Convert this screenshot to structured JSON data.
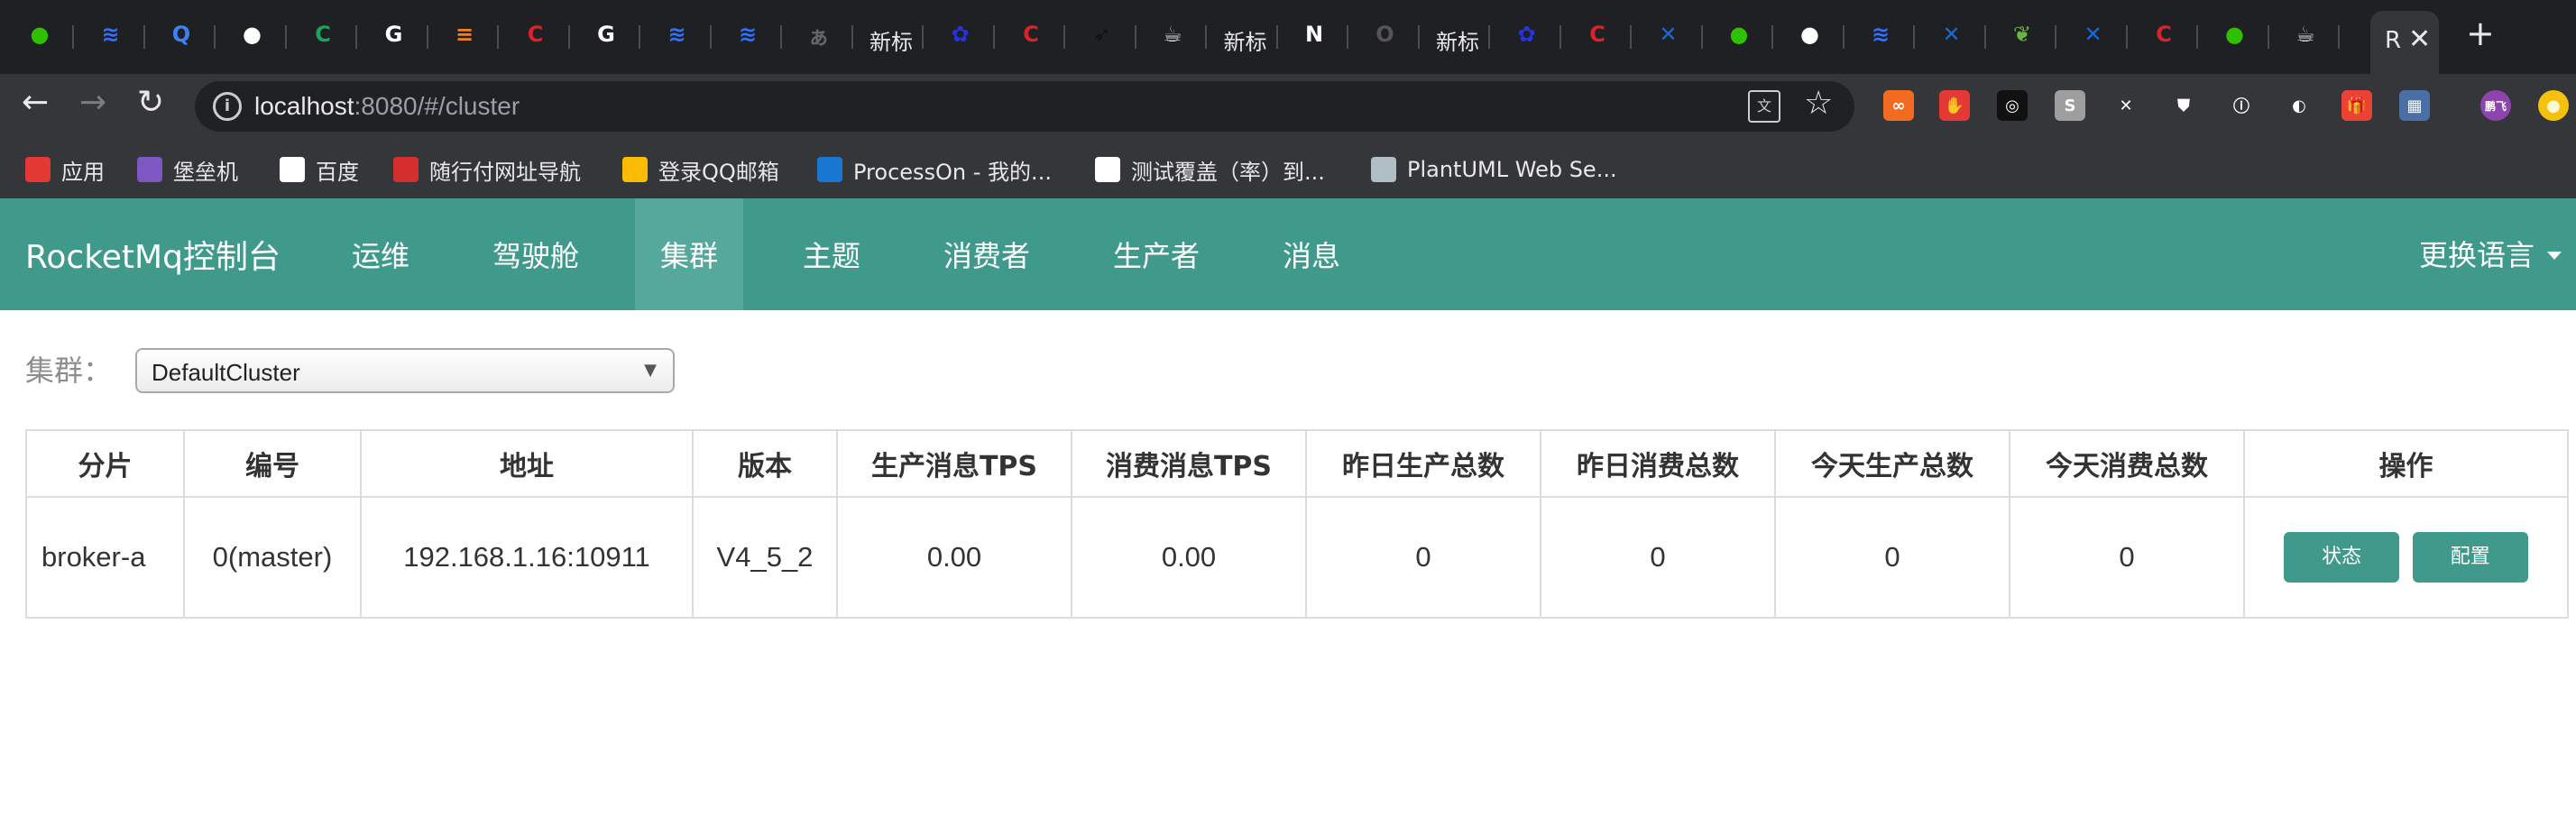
{
  "browser": {
    "tabs": [
      {
        "icon": "wechat-icon",
        "color": "#2dc100",
        "glyph": "●"
      },
      {
        "icon": "lark-icon",
        "color": "#3370ff",
        "glyph": "≋"
      },
      {
        "icon": "q-icon",
        "color": "#3b82f6",
        "glyph": "Q"
      },
      {
        "icon": "github-icon",
        "color": "#ffffff",
        "glyph": "●"
      },
      {
        "icon": "c-green-icon",
        "color": "#1aa35b",
        "glyph": "C"
      },
      {
        "icon": "google-icon",
        "color": "#ffffff",
        "glyph": "G"
      },
      {
        "icon": "stackoverflow-icon",
        "color": "#f48024",
        "glyph": "≡"
      },
      {
        "icon": "csdn-icon",
        "color": "#d8232a",
        "glyph": "C"
      },
      {
        "icon": "google-icon",
        "color": "#ffffff",
        "glyph": "G"
      },
      {
        "icon": "lark-icon",
        "color": "#3370ff",
        "glyph": "≋"
      },
      {
        "icon": "lark-icon",
        "color": "#3370ff",
        "glyph": "≋"
      },
      {
        "icon": "translate-icon",
        "color": "#666666",
        "glyph": "ぁ"
      },
      {
        "icon": "text-tab",
        "label": "新标"
      },
      {
        "icon": "baidu-icon",
        "color": "#2932e1",
        "glyph": "✿"
      },
      {
        "icon": "csdn-icon",
        "color": "#d8232a",
        "glyph": "C"
      },
      {
        "icon": "feather-icon",
        "color": "#111111",
        "glyph": "➶"
      },
      {
        "icon": "java-icon",
        "color": "#e0e0e0",
        "glyph": "☕"
      },
      {
        "icon": "text-tab",
        "label": "新标"
      },
      {
        "icon": "notion-icon",
        "color": "#ffffff",
        "glyph": "N"
      },
      {
        "icon": "o-icon",
        "color": "#555555",
        "glyph": "O"
      },
      {
        "icon": "text-tab",
        "label": "新标"
      },
      {
        "icon": "baidu-icon",
        "color": "#2932e1",
        "glyph": "✿"
      },
      {
        "icon": "csdn-icon",
        "color": "#d8232a",
        "glyph": "C"
      },
      {
        "icon": "confluence-icon",
        "color": "#1868db",
        "glyph": "✕"
      },
      {
        "icon": "wechat-icon",
        "color": "#2dc100",
        "glyph": "●"
      },
      {
        "icon": "github-icon",
        "color": "#ffffff",
        "glyph": "●"
      },
      {
        "icon": "lark-icon",
        "color": "#3370ff",
        "glyph": "≋"
      },
      {
        "icon": "confluence-icon",
        "color": "#1868db",
        "glyph": "✕"
      },
      {
        "icon": "spring-icon",
        "color": "#6db33f",
        "glyph": "❦"
      },
      {
        "icon": "confluence-icon",
        "color": "#1868db",
        "glyph": "✕"
      },
      {
        "icon": "csdn-icon",
        "color": "#d8232a",
        "glyph": "C"
      },
      {
        "icon": "wechat-icon",
        "color": "#2dc100",
        "glyph": "●"
      },
      {
        "icon": "java-icon",
        "color": "#e0e0e0",
        "glyph": "☕"
      }
    ],
    "active_tab_label": "R",
    "close_glyph": "✕",
    "new_tab_glyph": "+",
    "url_host": "localhost",
    "url_rest": ":8080/#/cluster",
    "info_glyph": "i",
    "translate_glyph": "文",
    "star_glyph": "☆",
    "extensions": [
      {
        "icon": "infinity-extension-icon",
        "color": "#f26b21",
        "glyph": "∞"
      },
      {
        "icon": "hand-extension-icon",
        "color": "#e53935",
        "glyph": "✋"
      },
      {
        "icon": "glasses-extension-icon",
        "color": "#111111",
        "glyph": "◎"
      },
      {
        "icon": "s-extension-icon",
        "color": "#9e9e9e",
        "glyph": "S"
      },
      {
        "icon": "x-extension-icon",
        "color": "#35363a",
        "glyph": "✕"
      },
      {
        "icon": "shield-extension-icon",
        "color": "#35363a",
        "glyph": "⛊"
      },
      {
        "icon": "circle-extension-icon",
        "color": "#35363a",
        "glyph": "ⓘ"
      },
      {
        "icon": "ninja-extension-icon",
        "color": "#35363a",
        "glyph": "◐"
      },
      {
        "icon": "gift-extension-icon",
        "color": "#ea4335",
        "glyph": "🎁"
      },
      {
        "icon": "image-extension-icon",
        "color": "#4a6fa5",
        "glyph": "▦"
      },
      {
        "icon": "profile-avatar",
        "color": "#8e44ad",
        "glyph": "鹏飞"
      },
      {
        "icon": "account-icon",
        "color": "#f4c20d",
        "glyph": "●"
      }
    ],
    "bookmarks": [
      {
        "icon": "apps-icon",
        "color": "#e53935",
        "label": "应用"
      },
      {
        "icon": "bastion-icon",
        "color": "#7e57c2",
        "label": "堡垒机"
      },
      {
        "icon": "baidu-bm-icon",
        "color": "#ffffff",
        "label": "百度"
      },
      {
        "icon": "suixingfu-icon",
        "color": "#d32f2f",
        "label": "随行付网址导航"
      },
      {
        "icon": "qqmail-icon",
        "color": "#fbbc05",
        "label": "登录QQ邮箱"
      },
      {
        "icon": "processon-icon",
        "color": "#1976d2",
        "label": "ProcessOn - 我的..."
      },
      {
        "icon": "infoq-icon",
        "color": "#ffffff",
        "label": "测试覆盖（率）到..."
      },
      {
        "icon": "plantuml-icon",
        "color": "#b0bec5",
        "label": "PlantUML Web Se..."
      }
    ]
  },
  "app": {
    "brand": "RocketMq控制台",
    "nav": [
      {
        "label": "运维",
        "active": false
      },
      {
        "label": "驾驶舱",
        "active": false
      },
      {
        "label": "集群",
        "active": true
      },
      {
        "label": "主题",
        "active": false
      },
      {
        "label": "消费者",
        "active": false
      },
      {
        "label": "生产者",
        "active": false
      },
      {
        "label": "消息",
        "active": false
      }
    ],
    "language_label": "更换语言",
    "accent_color": "#409a8c",
    "cluster_label": "集群：",
    "cluster_selected": "DefaultCluster",
    "select_arrow": "▼",
    "table": {
      "headers": [
        "分片",
        "编号",
        "地址",
        "版本",
        "生产消息TPS",
        "消费消息TPS",
        "昨日生产总数",
        "昨日消费总数",
        "今天生产总数",
        "今天消费总数",
        "操作"
      ],
      "rows": [
        {
          "shard": "broker-a",
          "id": "0(master)",
          "address": "192.168.1.16:10911",
          "version": "V4_5_2",
          "produce_tps": "0.00",
          "consume_tps": "0.00",
          "yesterday_produce": "0",
          "yesterday_consume": "0",
          "today_produce": "0",
          "today_consume": "0",
          "status_btn": "状态",
          "config_btn": "配置"
        }
      ]
    }
  }
}
